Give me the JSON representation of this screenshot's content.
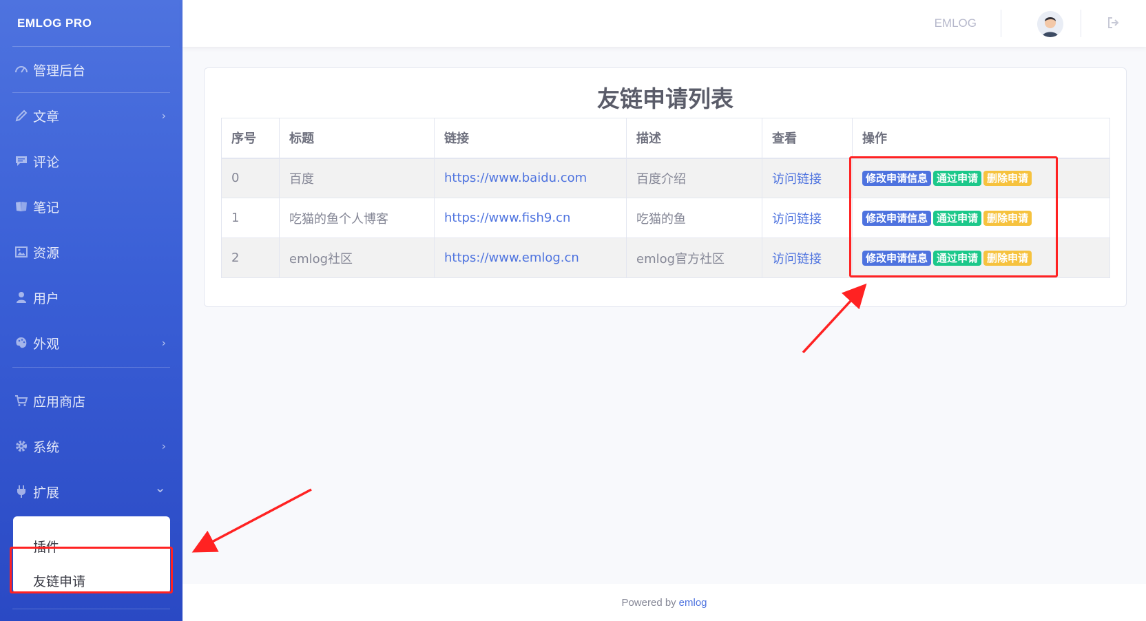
{
  "sidebar": {
    "brand": "EMLOG PRO",
    "items": [
      {
        "label": "管理后台",
        "icon": "dashboard-icon",
        "chevron": ""
      },
      {
        "label": "文章",
        "icon": "pencil-icon",
        "chevron": "›"
      },
      {
        "label": "评论",
        "icon": "comment-icon",
        "chevron": ""
      },
      {
        "label": "笔记",
        "icon": "note-icon",
        "chevron": ""
      },
      {
        "label": "资源",
        "icon": "image-icon",
        "chevron": ""
      },
      {
        "label": "用户",
        "icon": "user-icon",
        "chevron": ""
      },
      {
        "label": "外观",
        "icon": "palette-icon",
        "chevron": "›"
      },
      {
        "label": "应用商店",
        "icon": "cart-icon",
        "chevron": ""
      },
      {
        "label": "系统",
        "icon": "gear-icon",
        "chevron": "›"
      },
      {
        "label": "扩展",
        "icon": "plug-icon",
        "chevron": "⌄"
      }
    ],
    "submenu": [
      "插件",
      "友链申请"
    ]
  },
  "topbar": {
    "username": "EMLOG",
    "avatar_icon": "avatar-icon",
    "logout_icon": "logout-icon"
  },
  "card": {
    "title": "友链申请列表",
    "headers": [
      "序号",
      "标题",
      "链接",
      "描述",
      "查看",
      "操作"
    ],
    "rows": [
      {
        "id": "0",
        "title": "百度",
        "url": "https://www.baidu.com",
        "desc": "百度介绍",
        "view": "访问链接"
      },
      {
        "id": "1",
        "title": "吃猫的鱼个人博客",
        "url": "https://www.fish9.cn",
        "desc": "吃猫的鱼",
        "view": "访问链接"
      },
      {
        "id": "2",
        "title": "emlog社区",
        "url": "https://www.emlog.cn",
        "desc": "emlog官方社区",
        "view": "访问链接"
      }
    ],
    "actions": {
      "edit": "修改申请信息",
      "approve": "通过申请",
      "delete": "删除申请"
    }
  },
  "footer": {
    "prefix": "Powered by",
    "link": "emlog"
  },
  "colors": {
    "primary": "#4e73df",
    "success": "#1cc88a",
    "warning": "#f6c23e",
    "annotation": "#ff2222"
  }
}
